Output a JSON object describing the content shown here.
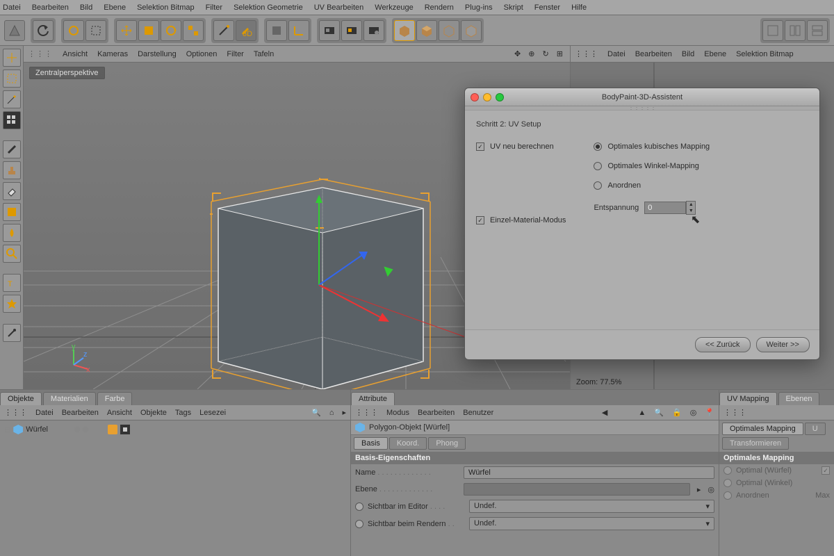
{
  "menu": [
    "Datei",
    "Bearbeiten",
    "Bild",
    "Ebene",
    "Selektion Bitmap",
    "Filter",
    "Selektion Geometrie",
    "UV Bearbeiten",
    "Werkzeuge",
    "Rendern",
    "Plug-ins",
    "Skript",
    "Fenster",
    "Hilfe"
  ],
  "viewbar": [
    "Ansicht",
    "Kameras",
    "Darstellung",
    "Optionen",
    "Filter",
    "Tafeln"
  ],
  "viewport_label": "Zentralperspektive",
  "rightbar": [
    "Datei",
    "Bearbeiten",
    "Bild",
    "Ebene",
    "Selektion Bitmap"
  ],
  "zoom": "Zoom: 77.5%",
  "dialog": {
    "title": "BodyPaint-3D-Assistent",
    "step": "Schritt 2: UV Setup",
    "uv_recalc": "UV neu berechnen",
    "opt_cubic": "Optimales kubisches Mapping",
    "opt_angle": "Optimales Winkel-Mapping",
    "opt_arrange": "Anordnen",
    "relax_label": "Entspannung",
    "relax_value": "0",
    "single_mat": "Einzel-Material-Modus",
    "back": "<<  Zurück",
    "next": "Weiter  >>"
  },
  "obj_panel": {
    "tabs": [
      "Objekte",
      "Materialien",
      "Farbe"
    ],
    "bar": [
      "Datei",
      "Bearbeiten",
      "Ansicht",
      "Objekte",
      "Tags",
      "Lesezei"
    ],
    "item": "Würfel"
  },
  "attr_panel": {
    "tab": "Attribute",
    "bar": [
      "Modus",
      "Bearbeiten",
      "Benutzer"
    ],
    "obj_type": "Polygon-Objekt [Würfel]",
    "subtabs": [
      "Basis",
      "Koord.",
      "Phong"
    ],
    "section": "Basis-Eigenschaften",
    "props": {
      "name_l": "Name",
      "name_v": "Würfel",
      "ebene_l": "Ebene",
      "ebene_v": "",
      "sicht_ed_l": "Sichtbar im Editor",
      "sicht_ed_v": "Undef.",
      "sicht_rn_l": "Sichtbar beim Rendern",
      "sicht_rn_v": "Undef."
    }
  },
  "uv_panel": {
    "tabs": [
      "UV Mapping",
      "Ebenen"
    ],
    "sub1": "Optimales Mapping",
    "sub1b": "U",
    "sub2": "Transformieren",
    "section": "Optimales Mapping",
    "opt_cube": "Optimal (Würfel)",
    "opt_angle": "Optimal (Winkel)",
    "arrange": "Anordnen",
    "max": "Max"
  }
}
